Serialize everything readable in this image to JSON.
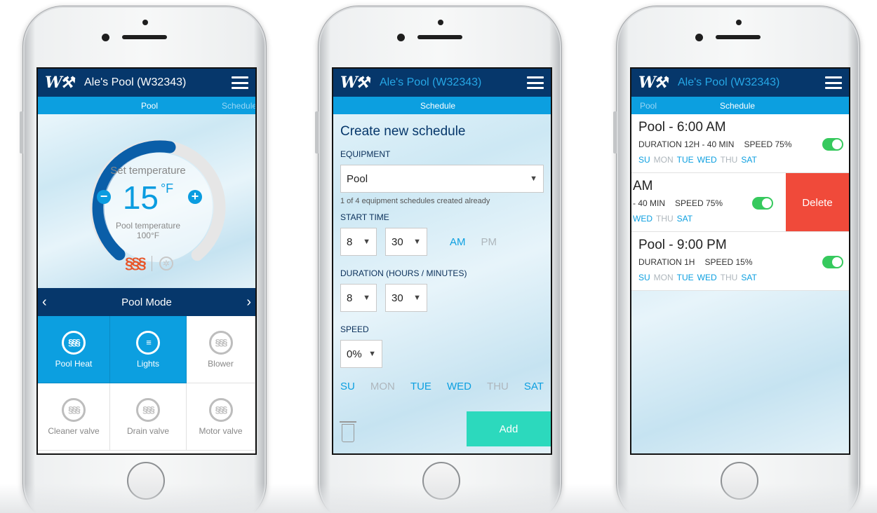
{
  "colors": {
    "navy": "#06376b",
    "blue": "#0c9fe0",
    "teal": "#2cd9bd",
    "red": "#f04a3a",
    "green": "#36c95d",
    "heat": "#e8562a"
  },
  "phone1": {
    "app_title": "Ale's Pool (W32343)",
    "tabs": [
      "Pool",
      "Schedule"
    ],
    "set_label": "Set temperature",
    "temp_value": "15",
    "temp_unit": "°F",
    "pool_label": "Pool temperature",
    "pool_value": "100°F",
    "minus": "−",
    "plus": "+",
    "mode_title": "Pool Mode",
    "mode_prev": "‹",
    "mode_next": "›",
    "modes": [
      {
        "label": "Pool Heat",
        "active": true,
        "icon": "heat-icon"
      },
      {
        "label": "Lights",
        "active": true,
        "icon": "light-bulb-icon"
      },
      {
        "label": "Blower",
        "active": false,
        "icon": "heat-icon"
      },
      {
        "label": "Cleaner valve",
        "active": false,
        "icon": "heat-icon"
      },
      {
        "label": "Drain valve",
        "active": false,
        "icon": "heat-icon"
      },
      {
        "label": "Motor valve",
        "active": false,
        "icon": "heat-icon"
      }
    ]
  },
  "phone2": {
    "app_title": "Ale's Pool (W32343)",
    "tab": "Schedule",
    "form_title": "Create new schedule",
    "equipment_label": "EQUIPMENT",
    "equipment_value": "Pool",
    "equipment_note": "1 of 4 equipment schedules created already",
    "start_label": "START TIME",
    "start_hour": "8",
    "start_min": "30",
    "am": "AM",
    "pm": "PM",
    "duration_label": "DURATION (HOURS / MINUTES)",
    "dur_hours": "8",
    "dur_min": "30",
    "speed_label": "SPEED",
    "speed_value": "0%",
    "days": [
      {
        "d": "SU",
        "on": true
      },
      {
        "d": "MON",
        "on": false
      },
      {
        "d": "TUE",
        "on": true
      },
      {
        "d": "WED",
        "on": true
      },
      {
        "d": "THU",
        "on": false
      },
      {
        "d": "SAT",
        "on": true
      }
    ],
    "add_label": "Add"
  },
  "phone3": {
    "app_title": "Ale's Pool (W32343)",
    "tabs": [
      "Pool",
      "Schedule"
    ],
    "schedules": [
      {
        "title": "Pool - 6:00 AM",
        "duration": "DURATION 12H - 40 MIN",
        "speed": "SPEED 75%"
      },
      {
        "title": "AM",
        "duration": "- 40 MIN",
        "speed": "SPEED 75%"
      },
      {
        "title": "Pool - 9:00 PM",
        "duration": "DURATION 1H",
        "speed": "SPEED 15%"
      }
    ],
    "days_row": [
      "SU",
      "MON",
      "TUE",
      "WED",
      "THU",
      "SAT"
    ],
    "days_on": [
      true,
      false,
      true,
      true,
      false,
      true
    ],
    "swiped_days": [
      "WED",
      "THU",
      "SAT"
    ],
    "swiped_on": [
      true,
      false,
      true
    ],
    "delete_label": "Delete"
  }
}
